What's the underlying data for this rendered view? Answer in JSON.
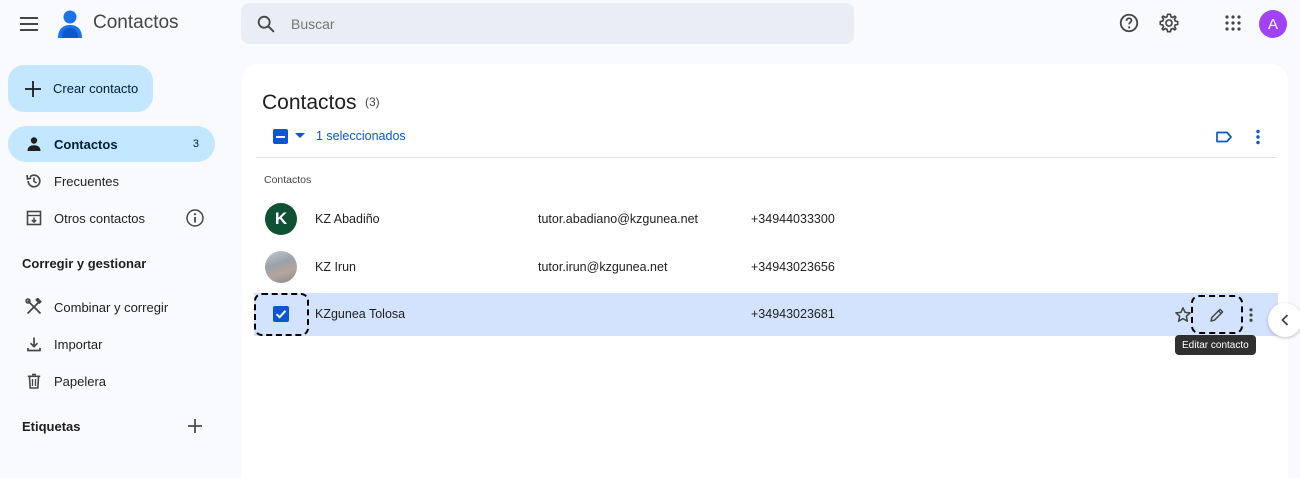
{
  "header": {
    "app_title": "Contactos",
    "search_placeholder": "Buscar",
    "avatar_letter": "A",
    "avatar_color": "#a142f4"
  },
  "sidebar": {
    "create_label": "Crear contacto",
    "items": [
      {
        "label": "Contactos",
        "count": "3",
        "icon": "person-icon",
        "active": true
      },
      {
        "label": "Frecuentes",
        "icon": "history-icon"
      },
      {
        "label": "Otros contactos",
        "icon": "archive-icon"
      }
    ],
    "section_fix": "Corregir y gestionar",
    "fix_items": [
      {
        "label": "Combinar y corregir",
        "icon": "tools-icon"
      },
      {
        "label": "Importar",
        "icon": "download-icon"
      },
      {
        "label": "Papelera",
        "icon": "trash-icon"
      }
    ],
    "labels_header": "Etiquetas"
  },
  "main": {
    "title": "Contactos",
    "count": "(3)",
    "selection_text": "1 seleccionados",
    "list_header": "Contactos",
    "contacts": [
      {
        "name": "KZ Abadiño",
        "email": "tutor.abadiano@kzgunea.net",
        "phone": "+34944033300",
        "initial": "K",
        "avatar_color": "#0f5132"
      },
      {
        "name": "KZ Irun",
        "email": "tutor.irun@kzgunea.net",
        "phone": "+34943023656",
        "initial": "",
        "avatar_color": "#8a8f96"
      },
      {
        "name": "KZgunea Tolosa",
        "email": "",
        "phone": "+34943023681",
        "selected": true
      }
    ],
    "tooltip": "Editar contacto"
  },
  "colors": {
    "accent": "#0b57d0",
    "selected_row": "#d3e3fd",
    "nav_active": "#c2e7ff"
  }
}
